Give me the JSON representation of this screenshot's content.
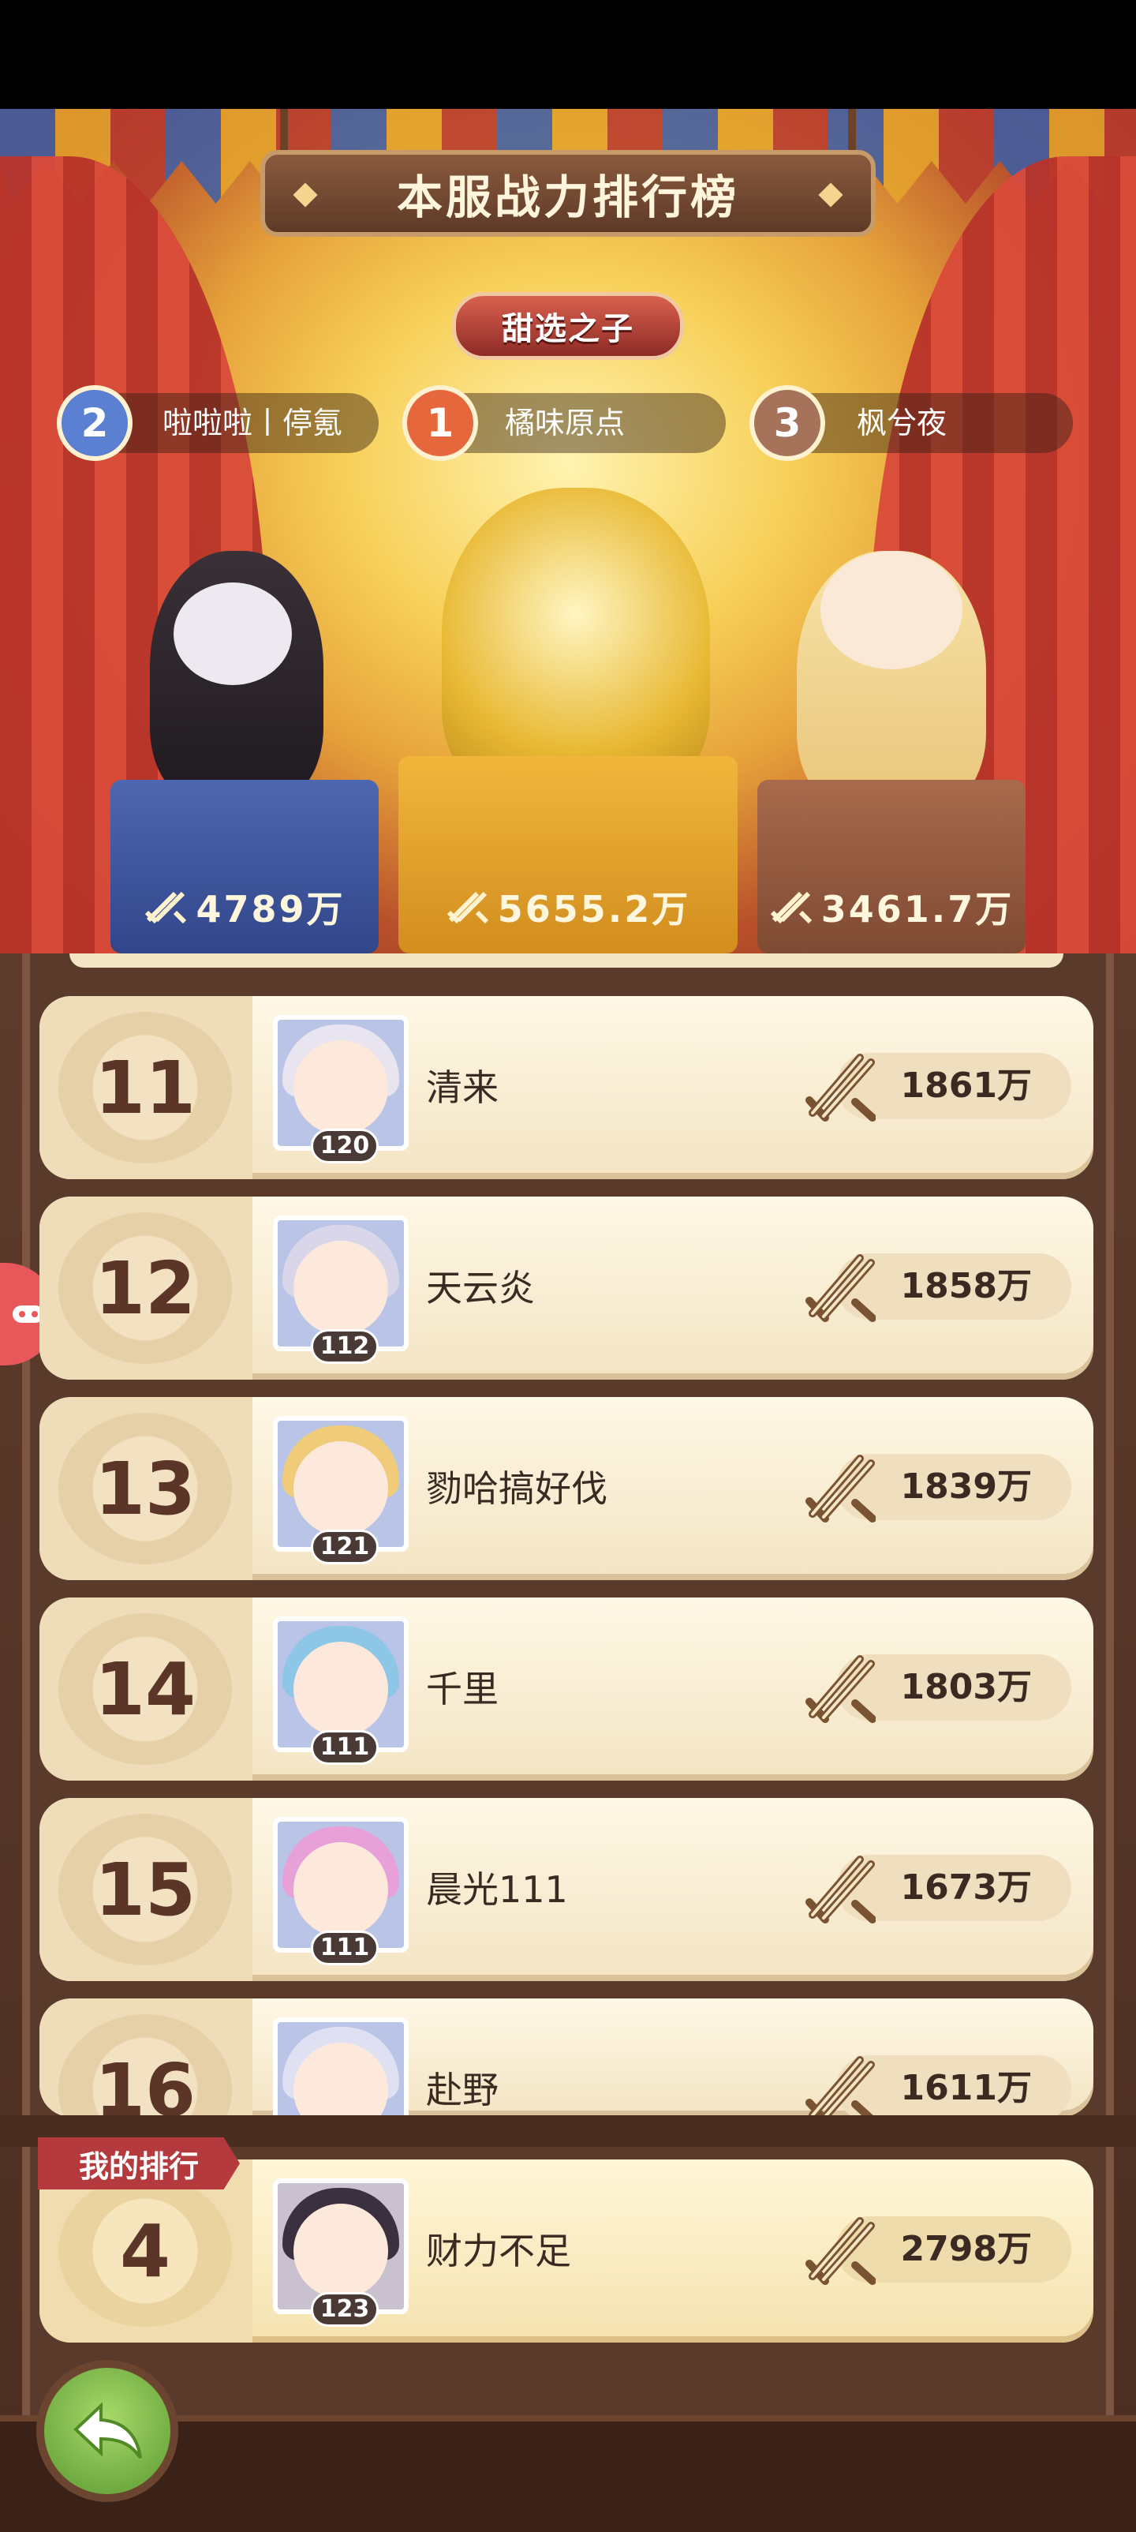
{
  "header": {
    "title": "本服战力排行榜",
    "subtitle": "甜选之子"
  },
  "top3": [
    {
      "rank": "2",
      "name": "啦啦啦丨停氪",
      "power": "4789万",
      "medal_color": "#5b7fd1"
    },
    {
      "rank": "1",
      "name": "橘味原点",
      "power": "5655.2万",
      "medal_color": "#e5673b"
    },
    {
      "rank": "3",
      "name": "枫兮夜",
      "power": "3461.7万",
      "medal_color": "#a6735a"
    }
  ],
  "ranking": [
    {
      "rank": "11",
      "name": "清来",
      "level": "120",
      "power": "1861万",
      "hair": "#e8e4f0"
    },
    {
      "rank": "12",
      "name": "天云炎",
      "level": "112",
      "power": "1858万",
      "hair": "#d8d6e8"
    },
    {
      "rank": "13",
      "name": "勠哈搞好伐",
      "level": "121",
      "power": "1839万",
      "hair": "#f0cc7a"
    },
    {
      "rank": "14",
      "name": "千里",
      "level": "111",
      "power": "1803万",
      "hair": "#8ec6e8"
    },
    {
      "rank": "15",
      "name": "晨光111",
      "level": "111",
      "power": "1673万",
      "hair": "#e8a0d8"
    },
    {
      "rank": "16",
      "name": "赴野",
      "level": "",
      "power": "1611万",
      "hair": "#dfe0f2"
    }
  ],
  "my_rank": {
    "tab_label": "我的排行",
    "rank": "4",
    "name": "财力不足",
    "level": "123",
    "power": "2798万",
    "hair": "#3a3040"
  },
  "colors": {
    "accent_red": "#b43a3e",
    "row_bg": "#fff8e6",
    "text_dark": "#3b2a22"
  }
}
